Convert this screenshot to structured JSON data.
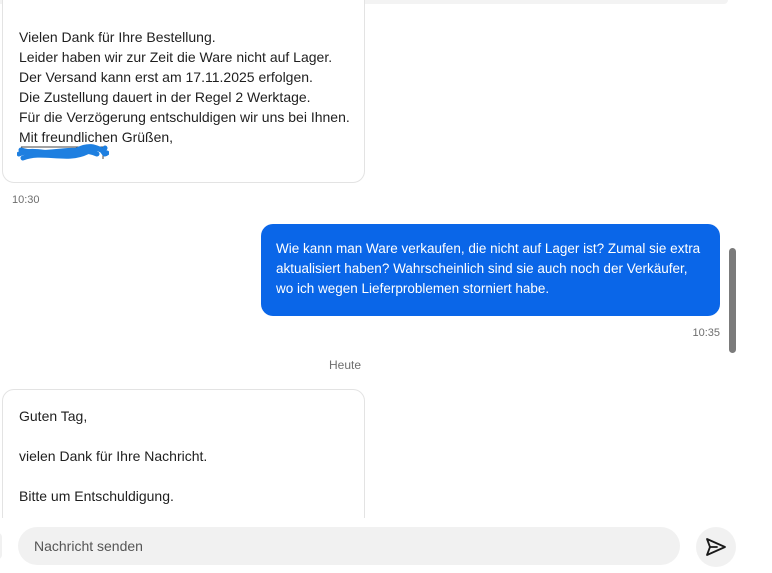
{
  "conversation": {
    "message1": {
      "lines": [
        "Vielen Dank für Ihre Bestellung.",
        "Leider haben wir zur Zeit die Ware nicht auf Lager.",
        "Der Versand kann erst am 17.11.2025 erfolgen.",
        "Die Zustellung dauert in der Regel 2 Werktage.",
        "Für die Verzögerung entschuldigen wir uns bei Ihnen.",
        "Mit freundlichen Grüßen,"
      ],
      "time": "10:30"
    },
    "message2": {
      "text": "Wie kann man Ware verkaufen, die nicht auf Lager ist? Zumal sie extra aktualisiert haben? Wahrscheinlich sind sie auch noch der Verkäufer, wo ich wegen Lieferproblemen storniert habe.",
      "time": "10:35"
    },
    "day_separator": "Heute",
    "message3": {
      "lines": [
        "Guten Tag,",
        "vielen Dank für Ihre Nachricht.",
        "Bitte um Entschuldigung."
      ]
    }
  },
  "composer": {
    "placeholder": "Nachricht senden"
  },
  "icons": {
    "send": "send-icon",
    "redaction": "redaction-scribble"
  },
  "colors": {
    "outgoing_bubble": "#0a66e8",
    "redaction": "#1e7fe0"
  }
}
